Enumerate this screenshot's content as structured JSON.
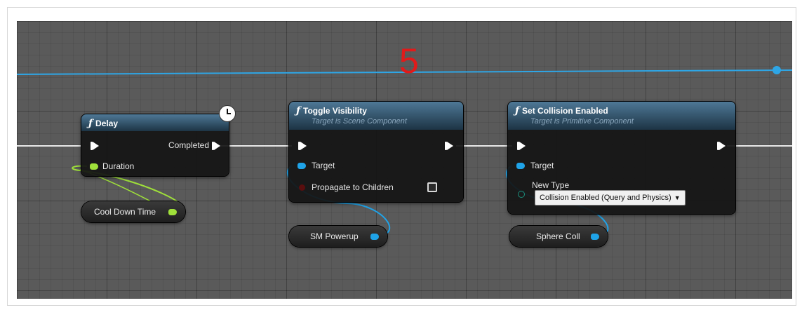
{
  "annotation": {
    "step_number": "5",
    "color": "#e11a1a"
  },
  "colors": {
    "exec_wire": "#ffffff",
    "object_pin": "#1fa3e8",
    "float_pin": "#9fe03a"
  },
  "nodes": {
    "delay": {
      "title": "Delay",
      "outputs": {
        "completed": "Completed"
      },
      "inputs": {
        "duration": "Duration"
      },
      "icon": "clock-icon"
    },
    "toggle_visibility": {
      "title": "Toggle Visibility",
      "subtitle": "Target is Scene Component",
      "inputs": {
        "target": "Target",
        "propagate": "Propagate to Children"
      },
      "propagate_checked": false
    },
    "set_collision": {
      "title": "Set Collision Enabled",
      "subtitle": "Target is Primitive Component",
      "inputs": {
        "target": "Target",
        "new_type": "New Type"
      },
      "new_type_value": "Collision Enabled (Query and Physics)"
    }
  },
  "variables": {
    "cool_down_time": "Cool Down Time",
    "sm_powerup": "SM Powerup",
    "sphere_coll": "Sphere Coll"
  }
}
